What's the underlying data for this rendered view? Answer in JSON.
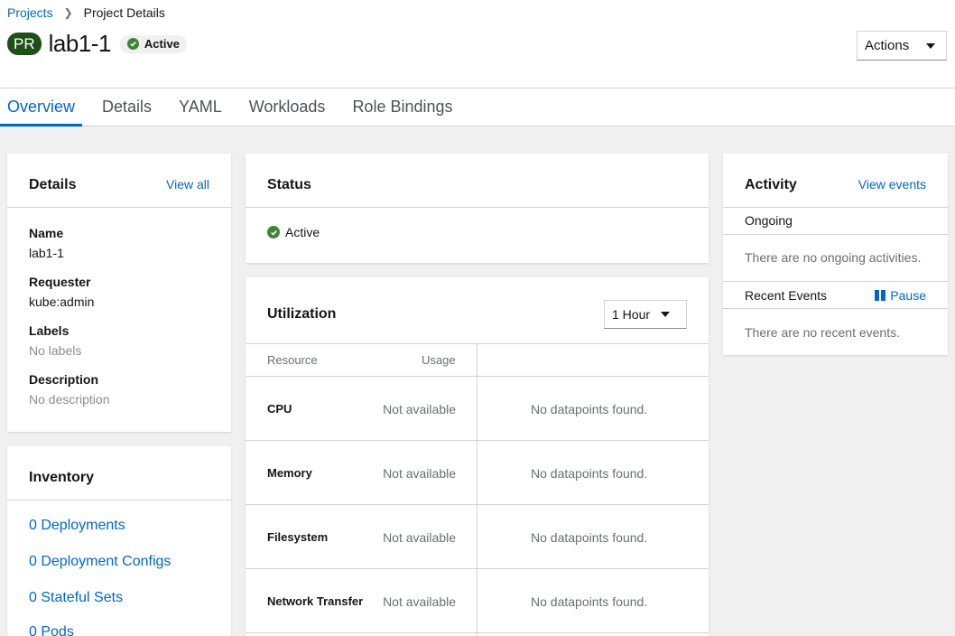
{
  "breadcrumb": {
    "projects": "Projects",
    "current": "Project Details"
  },
  "header": {
    "badge": "PR",
    "title": "lab1-1",
    "status": "Active",
    "actions": "Actions"
  },
  "tabs": [
    "Overview",
    "Details",
    "YAML",
    "Workloads",
    "Role Bindings"
  ],
  "details_card": {
    "title": "Details",
    "view_all": "View all",
    "fields": [
      {
        "label": "Name",
        "value": "lab1-1"
      },
      {
        "label": "Requester",
        "value": "kube:admin"
      },
      {
        "label": "Labels",
        "value": "No labels"
      },
      {
        "label": "Description",
        "value": "No description"
      }
    ]
  },
  "inventory_card": {
    "title": "Inventory",
    "items": [
      "0 Deployments",
      "0 Deployment Configs",
      "0 Stateful Sets",
      "0 Pods"
    ]
  },
  "status_card": {
    "title": "Status",
    "status": "Active"
  },
  "utilization_card": {
    "title": "Utilization",
    "range": "1 Hour",
    "col_resource": "Resource",
    "col_usage": "Usage",
    "rows": [
      {
        "resource": "CPU",
        "usage": "Not available",
        "chart": "No datapoints found."
      },
      {
        "resource": "Memory",
        "usage": "Not available",
        "chart": "No datapoints found."
      },
      {
        "resource": "Filesystem",
        "usage": "Not available",
        "chart": "No datapoints found."
      },
      {
        "resource": "Network Transfer",
        "usage": "Not available",
        "chart": "No datapoints found."
      }
    ]
  },
  "activity_card": {
    "title": "Activity",
    "view_events": "View events",
    "ongoing": "Ongoing",
    "ongoing_empty": "There are no ongoing activities.",
    "recent": "Recent Events",
    "pause": "Pause",
    "recent_empty": "There are no recent events."
  },
  "colors": {
    "accent": "#0066cc",
    "success": "#3e8635",
    "project_badge": "#1e4f18"
  }
}
